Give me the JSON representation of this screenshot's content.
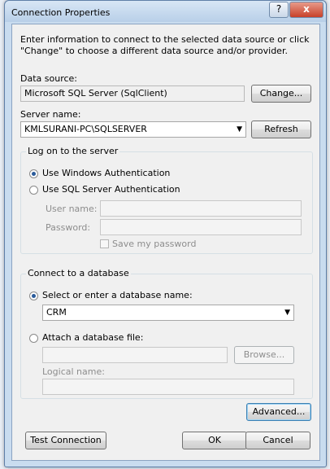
{
  "dialog": {
    "title": "Connection Properties",
    "help_glyph": "?",
    "close_glyph": "x",
    "intro": "Enter information to connect to the selected data source or click \"Change\" to choose a different data source and/or provider."
  },
  "data_source": {
    "label": "Data source:",
    "value": "Microsoft SQL Server (SqlClient)",
    "change_button": "Change..."
  },
  "server": {
    "label": "Server name:",
    "value": "KMLSURANI-PC\\SQLSERVER",
    "refresh_button": "Refresh"
  },
  "logon": {
    "group_label": "Log on to the server",
    "windows_auth": "Use Windows Authentication",
    "sql_auth": "Use SQL Server Authentication",
    "selected": "windows",
    "user_name_label": "User name:",
    "user_name_value": "",
    "password_label": "Password:",
    "password_value": "",
    "save_password": "Save my password",
    "save_password_checked": false
  },
  "database": {
    "group_label": "Connect to a database",
    "select_option": "Select or enter a database name:",
    "database_name": "CRM",
    "attach_option": "Attach a database file:",
    "attach_file_value": "",
    "browse_button": "Browse...",
    "logical_name_label": "Logical name:",
    "logical_name_value": "",
    "selected": "select"
  },
  "buttons": {
    "advanced": "Advanced...",
    "test_connection": "Test Connection",
    "ok": "OK",
    "cancel": "Cancel"
  },
  "icons": {
    "dropdown": "▼"
  }
}
